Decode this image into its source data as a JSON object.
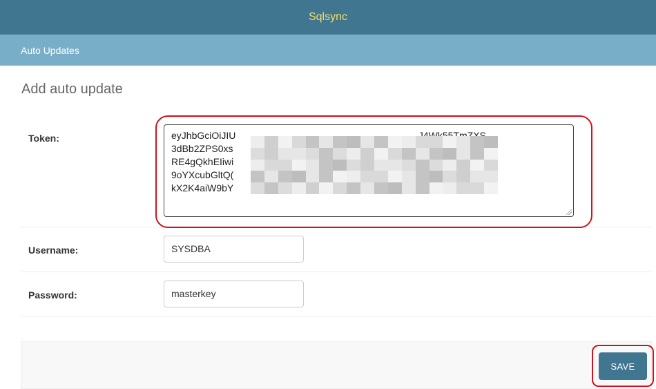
{
  "header": {
    "title": "Sqlsync"
  },
  "breadcrumbs": {
    "current": "Auto Updates"
  },
  "form": {
    "title": "Add auto update",
    "token": {
      "label": "Token:",
      "value": "eyJhbGciOiJIU                                                                    J4Wk55TmZXS\n3dBb2ZPS0xs                                                                    0VSTUVOVCBT\nRE4gQkhEIiwi                                                                    VkQnkiOiJqb2\n9oYXcubGltQ(                                                                    HmM4mbCsF\nkX2K4aiW9bY"
    },
    "username": {
      "label": "Username:",
      "value": "SYSDBA"
    },
    "password": {
      "label": "Password:",
      "value": "masterkey"
    }
  },
  "actions": {
    "save_label": "SAVE"
  },
  "colors": {
    "header_bg": "#417690",
    "header_text": "#f5dd5d",
    "breadcrumbs_bg": "#79aec8",
    "button_bg": "#417690",
    "highlight": "#d0101c"
  }
}
